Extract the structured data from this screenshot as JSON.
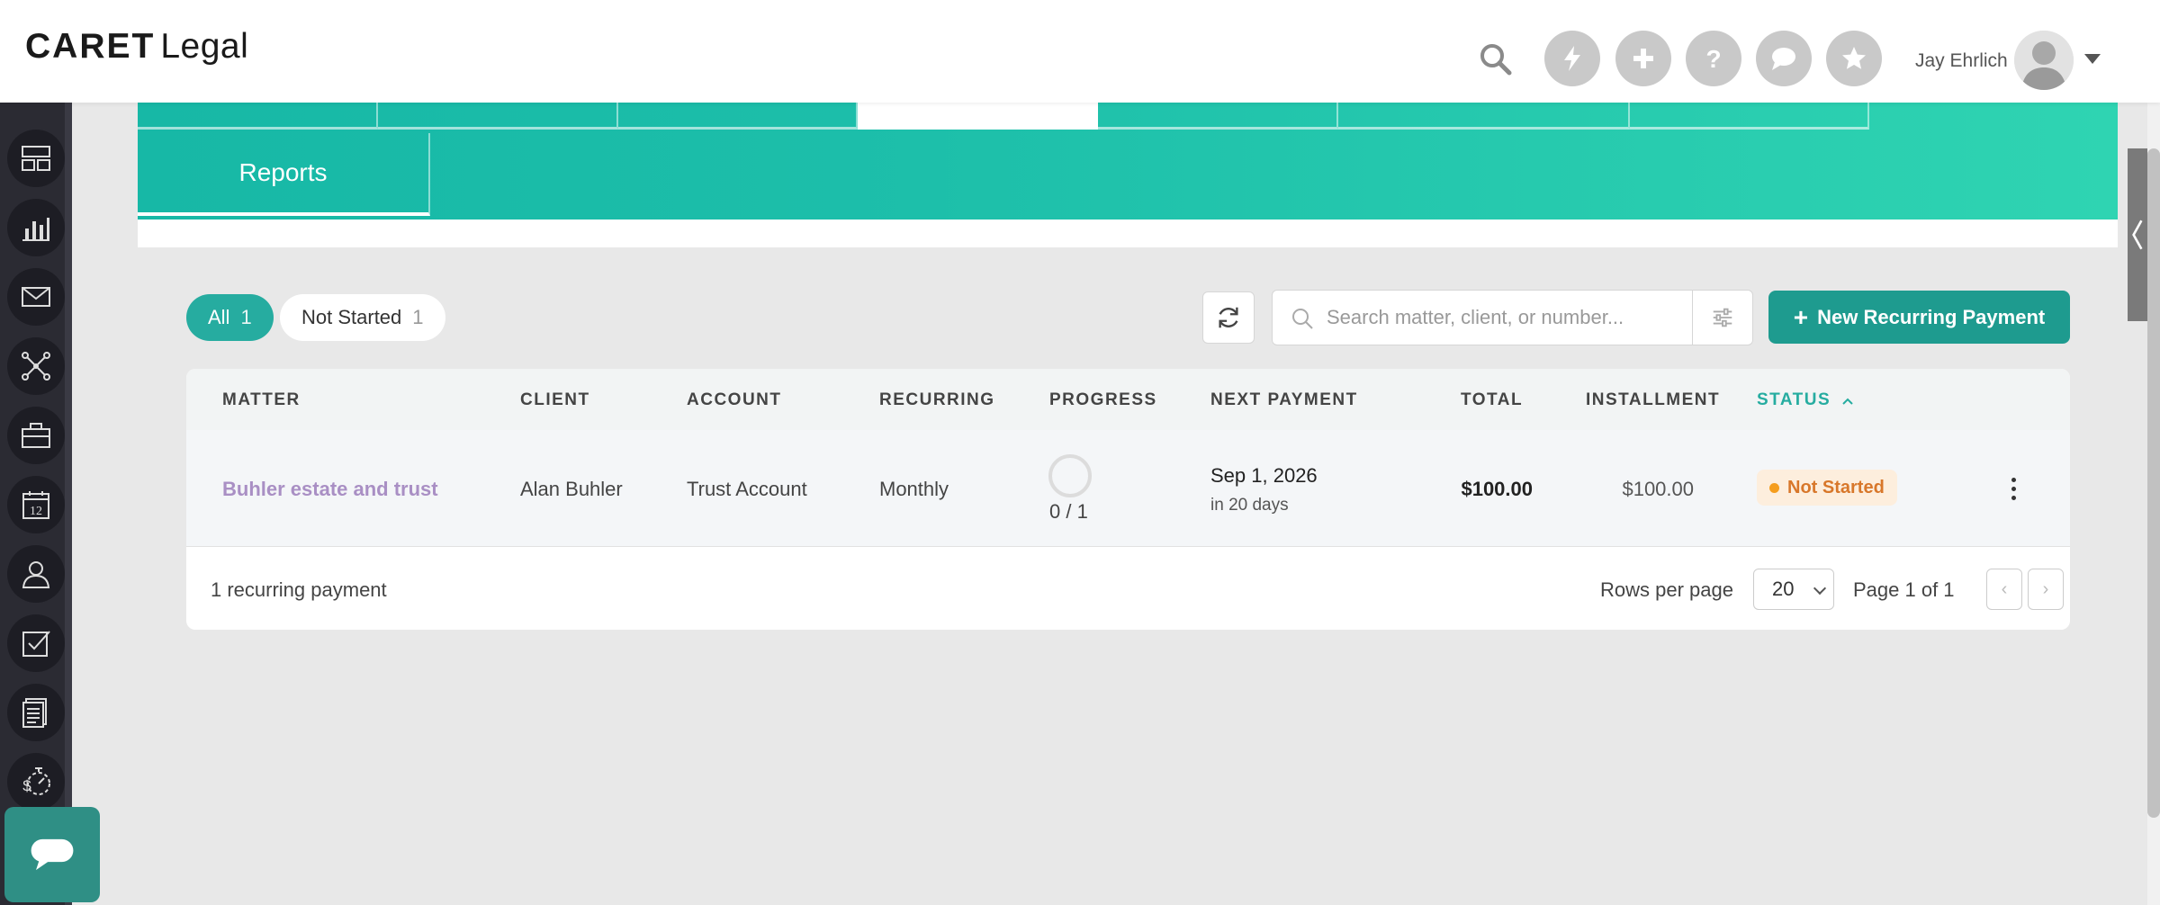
{
  "app": {
    "logo_brand": "CARET",
    "logo_product": "Legal"
  },
  "header": {
    "user_name": "Jay Ehrlich",
    "icons": [
      "search-icon",
      "lightning-icon",
      "plus-icon",
      "help-icon",
      "chat-icon",
      "star-icon"
    ]
  },
  "sidebar": {
    "items": [
      "dashboard-icon",
      "reports-icon",
      "mail-icon",
      "network-icon",
      "briefcase-icon",
      "calendar-icon",
      "contacts-icon",
      "tasks-icon",
      "documents-icon",
      "billing-time-icon"
    ],
    "calendar_day": "12"
  },
  "nav": {
    "reports_tab": "Reports"
  },
  "filters": {
    "all_label": "All",
    "all_count": "1",
    "not_started_label": "Not Started",
    "not_started_count": "1"
  },
  "search": {
    "placeholder": "Search matter, client, or number..."
  },
  "actions": {
    "new_button": "New Recurring Payment"
  },
  "table": {
    "headers": {
      "matter": "MATTER",
      "client": "CLIENT",
      "account": "ACCOUNT",
      "recurring": "RECURRING",
      "progress": "PROGRESS",
      "next_payment": "NEXT PAYMENT",
      "total": "TOTAL",
      "installment": "INSTALLMENT",
      "status": "STATUS"
    },
    "sort": {
      "column": "status",
      "direction": "ascending"
    },
    "rows": [
      {
        "matter": "Buhler estate and trust",
        "client": "Alan Buhler",
        "account": "Trust Account",
        "recurring": "Monthly",
        "progress": "0 / 1",
        "progress_fraction": 0,
        "next_payment": "Sep 1, 2026",
        "next_payment_relative": "in 20 days",
        "total": "$100.00",
        "installment": "$100.00",
        "status": "Not Started"
      }
    ]
  },
  "footer": {
    "count": "1 recurring payment",
    "rows_per_page_label": "Rows per page",
    "rows_per_page_value": "20",
    "page_info": "Page 1 of 1",
    "prev": "‹",
    "next": "›"
  },
  "colors": {
    "accent": "#26aca0",
    "button": "#1e9b8f",
    "matter_link": "#a98fc4",
    "status_not_started": "#d8772a",
    "sidebar_bg": "#2b2b33"
  }
}
